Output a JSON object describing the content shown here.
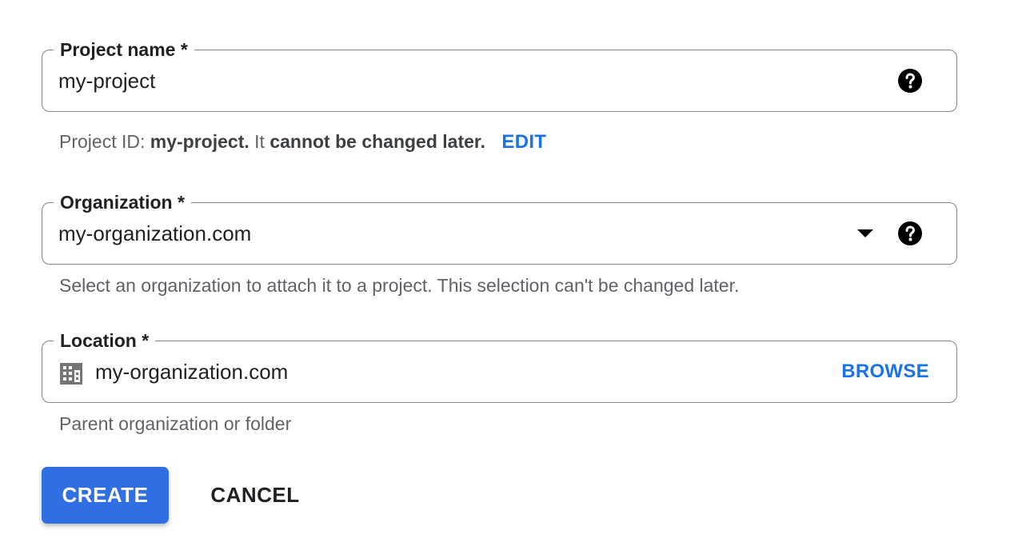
{
  "project_name": {
    "label": "Project name *",
    "value": "my-project",
    "help_icon": "help-circle-icon"
  },
  "project_id_hint": {
    "prefix": "Project ID: ",
    "id": "my-project.",
    "middle": " It ",
    "emphasis": "cannot be changed later.",
    "edit_label": "EDIT"
  },
  "organization": {
    "label": "Organization *",
    "value": "my-organization.com",
    "dropdown_icon": "arrow-drop-down-icon",
    "help_icon": "help-circle-icon",
    "hint": "Select an organization to attach it to a project. This selection can't be changed later."
  },
  "location": {
    "label": "Location *",
    "value": "my-organization.com",
    "icon": "building-icon",
    "browse_label": "BROWSE",
    "hint": "Parent organization or folder"
  },
  "actions": {
    "create_label": "CREATE",
    "cancel_label": "CANCEL"
  },
  "colors": {
    "primary": "#2f6ee3",
    "link": "#1a73e8",
    "border": "#80868b",
    "hint_text": "#5f6368"
  }
}
